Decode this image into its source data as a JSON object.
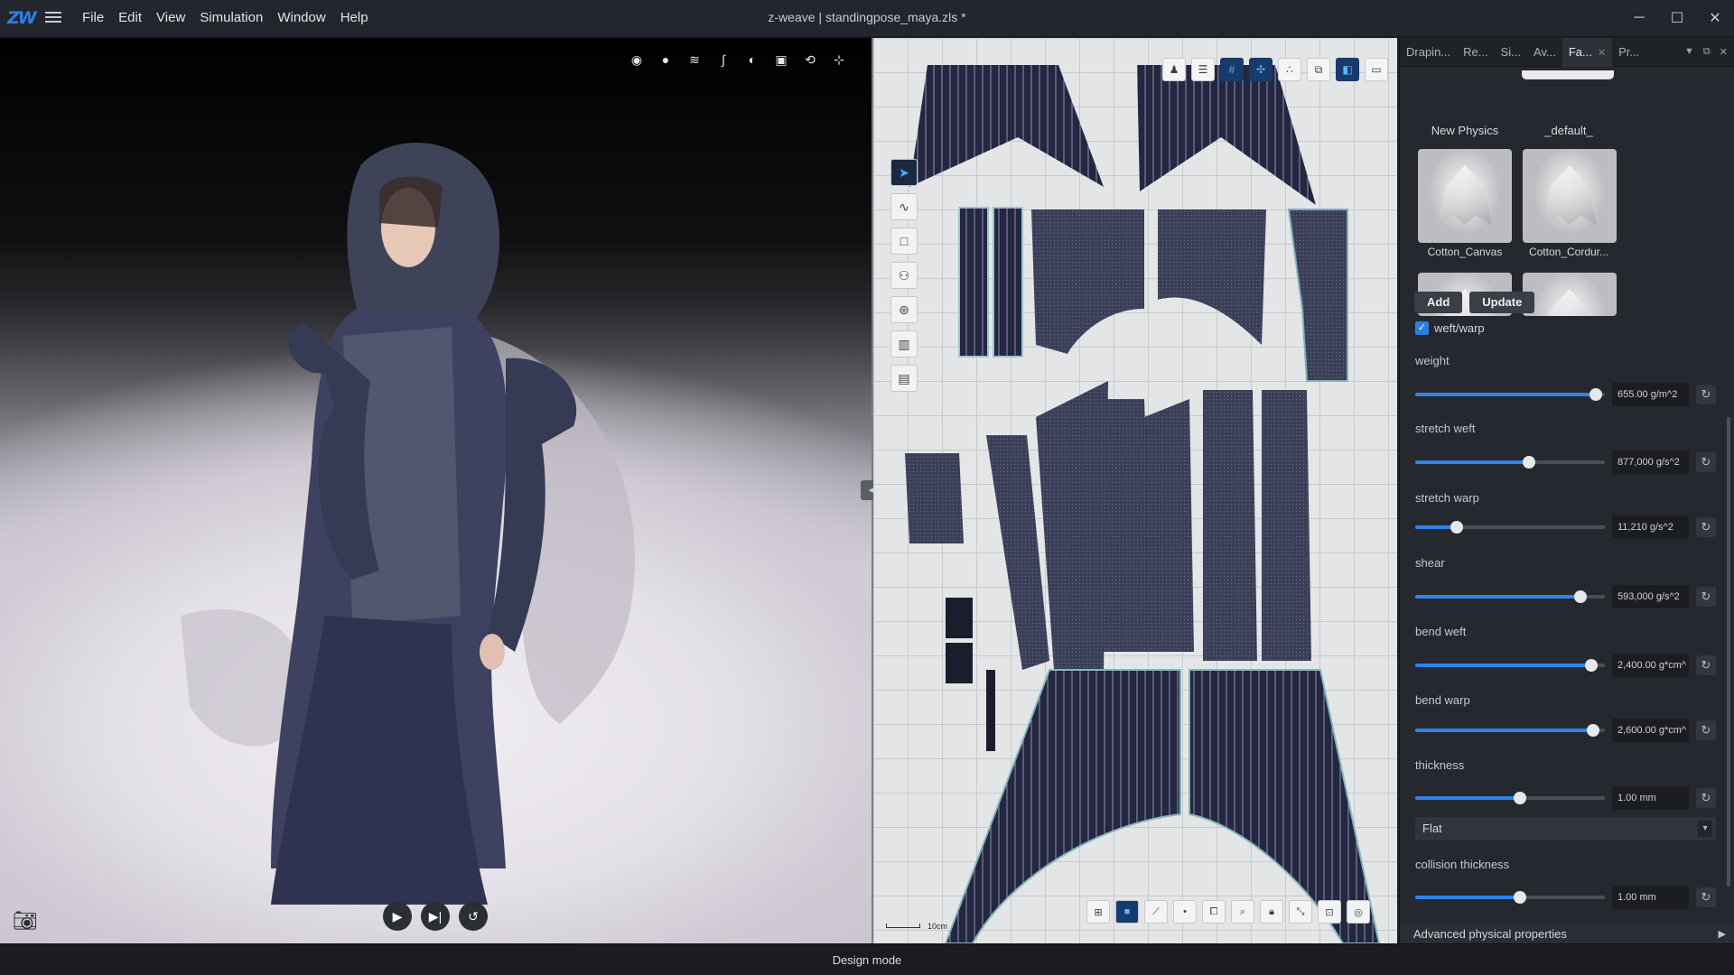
{
  "app": {
    "logo_text": "ZW",
    "window_title": "z-weave | standingpose_maya.zls *",
    "menu": [
      "File",
      "Edit",
      "View",
      "Simulation",
      "Window",
      "Help"
    ],
    "window_controls": [
      "minimize-icon",
      "maximize-icon",
      "close-icon"
    ]
  },
  "viewport3d": {
    "toolbar_icons": [
      "render-style-icon",
      "shading-sphere-icon",
      "layers-icon",
      "curve-icon",
      "texture-ball-icon",
      "garment-icon",
      "rotate-view-icon",
      "axis-icon"
    ],
    "playback": [
      "play-icon",
      "step-forward-icon",
      "reset-simulation-icon"
    ],
    "camera_icon": "camera-icon"
  },
  "pattern2d": {
    "toolbar_icons": [
      "avatar-icon",
      "pattern-list-icon",
      "grid-icon",
      "snap-icon",
      "points-icon",
      "arrange-icon",
      "pattern-view-icon",
      "ruler-icon"
    ],
    "left_tools": [
      "select-arrow-icon",
      "curve-tool-icon",
      "rectangle-tool-icon",
      "sewing-tool-icon",
      "button-tool-icon",
      "pleat-tool-icon",
      "measure-tool-icon"
    ],
    "bottom_tools": [
      "snap-tool-icon",
      "select-tool-icon",
      "edit-curve-icon",
      "point-icon",
      "transform-icon",
      "zoom-icon",
      "lock-icon",
      "resize-icon",
      "fit-icon",
      "target-icon"
    ],
    "scale_label": "10cm"
  },
  "panel": {
    "tabs": [
      {
        "label": "Drapin...",
        "active": false
      },
      {
        "label": "Re...",
        "active": false
      },
      {
        "label": "Si...",
        "active": false
      },
      {
        "label": "Av...",
        "active": false
      },
      {
        "label": "Fa...",
        "active": true
      },
      {
        "label": "Pr...",
        "active": false
      }
    ],
    "fabrics_top": [
      "New Physics",
      "_default_"
    ],
    "fabrics": [
      "Cotton_Canvas",
      "Cotton_Cordur..."
    ],
    "add_label": "Add",
    "update_label": "Update",
    "weft_warp_label": "weft/warp",
    "weft_warp_checked": true,
    "properties": [
      {
        "label": "weight",
        "value": "655.00 g/m^2",
        "level": 0.95
      },
      {
        "label": "stretch weft",
        "value": "877,000 g/s^2",
        "level": 0.6
      },
      {
        "label": "stretch warp",
        "value": "11,210 g/s^2",
        "level": 0.22
      },
      {
        "label": "shear",
        "value": "593,000 g/s^2",
        "level": 0.87
      },
      {
        "label": "bend weft",
        "value": "2,400.00 g*cm^",
        "level": 0.93
      },
      {
        "label": "bend warp",
        "value": "2,600.00 g*cm^",
        "level": 0.94
      },
      {
        "label": "thickness",
        "value": "1.00 mm",
        "level": 0.55
      }
    ],
    "thickness_mode": "Flat",
    "collision": {
      "label": "collision thickness",
      "value": "1.00 mm",
      "level": 0.55
    },
    "advanced_label": "Advanced physical properties"
  },
  "status": {
    "mode": "Design mode"
  }
}
